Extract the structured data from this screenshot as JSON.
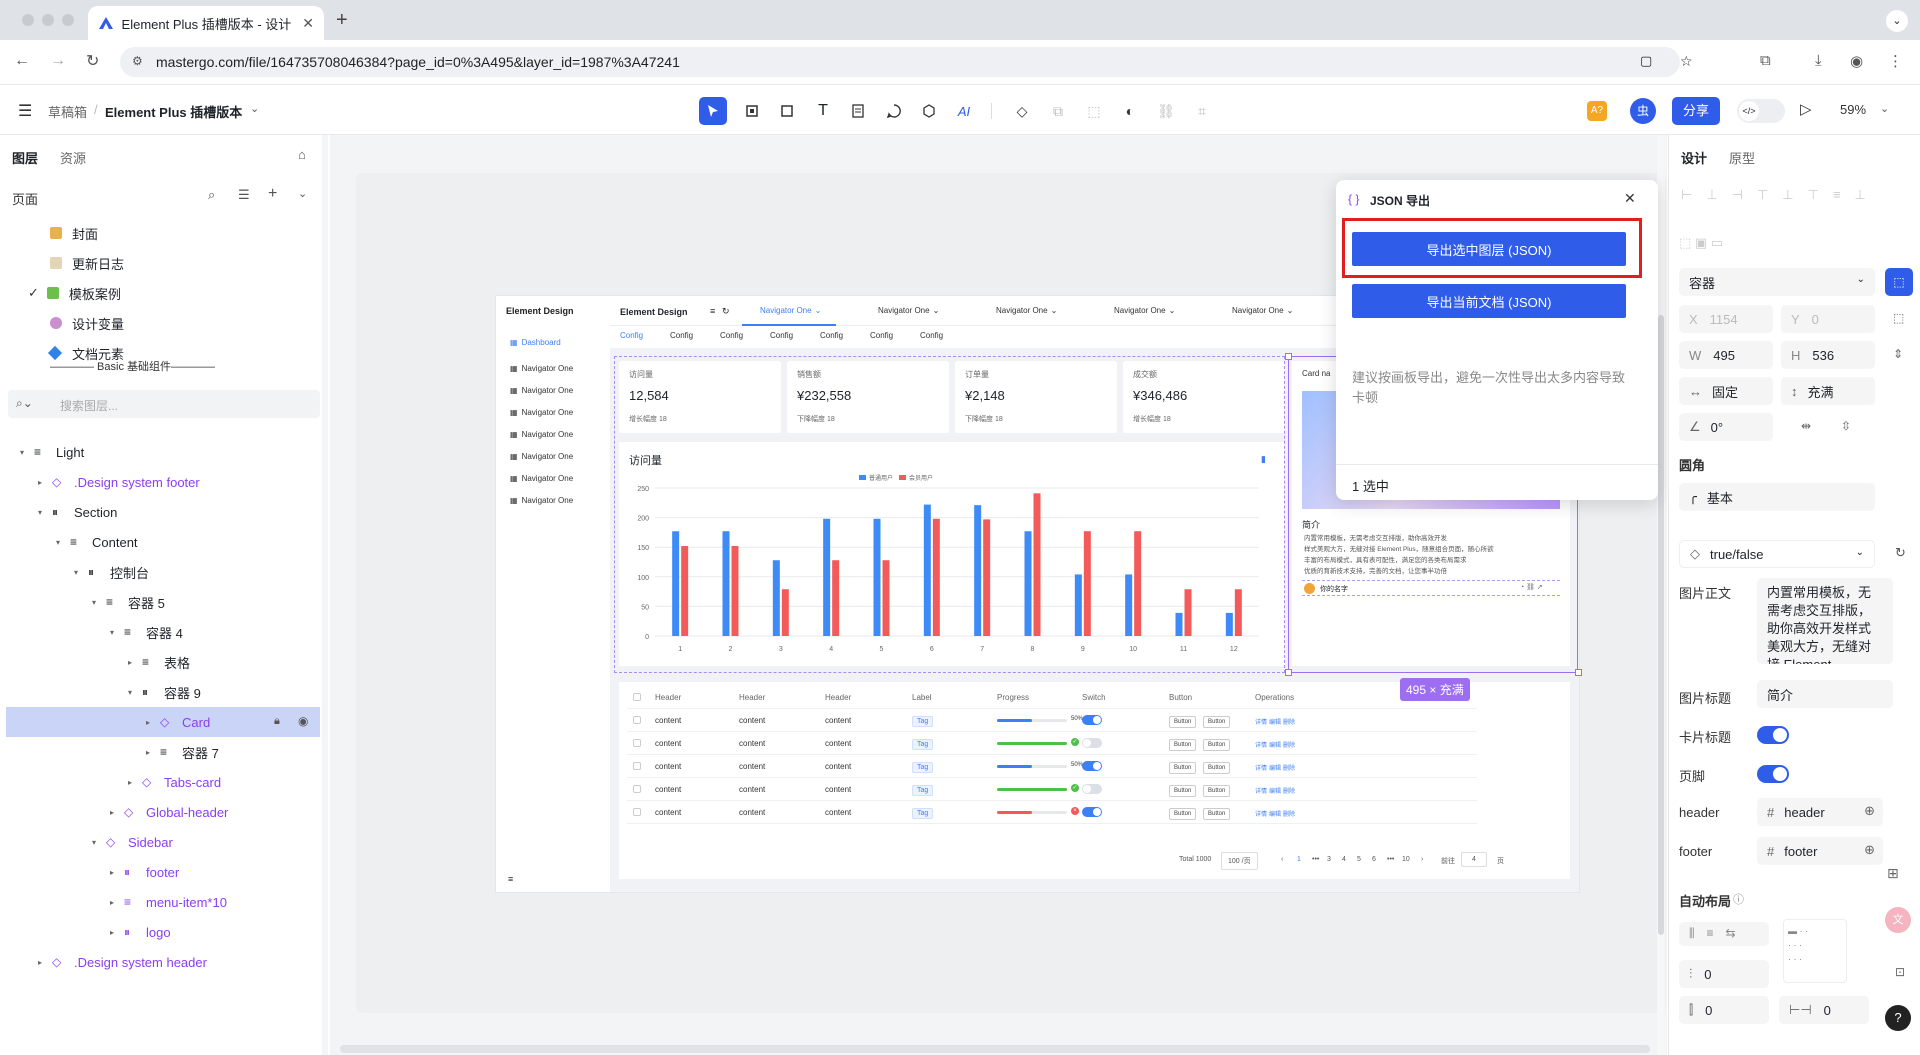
{
  "browser": {
    "tab_title": "Element Plus 插槽版本 - 设计",
    "url": "mastergo.com/file/164735708046384?page_id=0%3A495&layer_id=1987%3A47241"
  },
  "app": {
    "breadcrumb_root": "草稿箱",
    "file_name": "Element Plus 插槽版本",
    "share_label": "分享",
    "avatar_label": "虫",
    "warn_badge": "A?",
    "zoom": "59%"
  },
  "left": {
    "tabs": [
      "图层",
      "资源"
    ],
    "pages_label": "页面",
    "pages": [
      "封面",
      "更新日志",
      "模板案例",
      "设计变量",
      "文档元素",
      "———— Basic 基础组件————"
    ],
    "search_placeholder": "搜索图层...",
    "layers": [
      {
        "name": "Light"
      },
      {
        "name": ".Design system footer"
      },
      {
        "name": "Section"
      },
      {
        "name": "Content"
      },
      {
        "name": "控制台"
      },
      {
        "name": "容器 5"
      },
      {
        "name": "容器 4"
      },
      {
        "name": "表格"
      },
      {
        "name": "容器 9"
      },
      {
        "name": "Card"
      },
      {
        "name": "容器 7"
      },
      {
        "name": "Tabs-card"
      },
      {
        "name": "Global-header"
      },
      {
        "name": "Sidebar"
      },
      {
        "name": "footer"
      },
      {
        "name": "menu-item*10"
      },
      {
        "name": "logo"
      },
      {
        "name": ".Design system header"
      }
    ]
  },
  "right": {
    "tabs": [
      "设计",
      "原型"
    ],
    "container_select": "容器",
    "x": "1154",
    "y": "0",
    "w": "495",
    "h": "536",
    "x_label": "X",
    "y_label": "Y",
    "w_label": "W",
    "h_label": "H",
    "fixed": "固定",
    "fill": "充满",
    "rotation": "0°",
    "radius_label": "圆角",
    "radius_value": "基本",
    "variant_select": "true/false",
    "image_text_label": "图片正文",
    "image_text_value": "内置常用模板，无需考虑交互排版，助你高效开发样式美观大方，无缝对接 Element",
    "image_title_label": "图片标题",
    "image_title_value": "简介",
    "card_title_label": "卡片标题",
    "footer_toggle_label": "页脚",
    "header_label": "header",
    "header_value": "header",
    "footer_label": "footer",
    "footer_value": "footer",
    "autolayout_label": "自动布局",
    "pad1": "0",
    "pad2": "0",
    "pad3": "0"
  },
  "json_panel": {
    "title": "JSON 导出",
    "export_selected": "导出选中图层 (JSON)",
    "export_doc": "导出当前文档 (JSON)",
    "hint": "建议按画板导出，避免一次性导出太多内容导致卡顿",
    "selected_count": "1 选中"
  },
  "size_badge": "495 × 充满",
  "dashboard": {
    "logo": "Element Design",
    "sidebar_logo": "Element Design",
    "sidebar_active": "Dashboard",
    "sidebar_items": [
      "Navigator One",
      "Navigator One",
      "Navigator One",
      "Navigator One",
      "Navigator One",
      "Navigator One",
      "Navigator One"
    ],
    "top_nav": [
      "Navigator One",
      "Navigator One",
      "Navigator One",
      "Navigator One",
      "Navigator One"
    ],
    "sub_tabs": [
      "Config",
      "Config",
      "Config",
      "Config",
      "Config",
      "Config",
      "Config"
    ],
    "stats": [
      {
        "label": "访问量",
        "value": "12,584",
        "foot": "增长幅度 18"
      },
      {
        "label": "销售额",
        "value": "¥232,558",
        "foot": "下降幅度 18"
      },
      {
        "label": "订单量",
        "value": "¥2,148",
        "foot": "下降幅度 18"
      },
      {
        "label": "成交额",
        "value": "¥346,486",
        "foot": "增长幅度 18"
      }
    ],
    "card_header": "Card na",
    "card_title": "简介",
    "card_bullets": [
      "内置常用模板，无需考虑交互排版，助你高效开发",
      "样式美观大方，无缝对接 Element Plus，随意组合页面，随心所欲",
      "丰富的布局模式，具有表可配性，满足您的各类布局需求",
      "优质的育新技术支持，完善的文档，让您事半功倍"
    ],
    "card_user": "你的名字",
    "table": {
      "headers": [
        "Header",
        "Header",
        "Header",
        "Label",
        "Progress",
        "Switch",
        "Button",
        "Operations"
      ],
      "rows": [
        {
          "c1": "content",
          "c2": "content",
          "c3": "content",
          "tag": "Tag",
          "pct": "50%",
          "progress": 0.5,
          "on": true
        },
        {
          "c1": "content",
          "c2": "content",
          "c3": "content",
          "tag": "Tag",
          "pct": "",
          "progress": 1.0,
          "on": false
        },
        {
          "c1": "content",
          "c2": "content",
          "c3": "content",
          "tag": "Tag",
          "pct": "50%",
          "progress": 0.5,
          "on": true
        },
        {
          "c1": "content",
          "c2": "content",
          "c3": "content",
          "tag": "Tag",
          "pct": "",
          "progress": 1.0,
          "on": false
        },
        {
          "c1": "content",
          "c2": "content",
          "c3": "content",
          "tag": "Tag",
          "pct": "",
          "progress": 0.5,
          "on": true
        }
      ],
      "btn": "Button",
      "ops": [
        "详情",
        "编辑",
        "删除"
      ]
    },
    "pagination": {
      "total": "Total 1000",
      "per": "100 /页",
      "pages": [
        "1",
        "•••",
        "3",
        "4",
        "5",
        "6",
        "•••",
        "10"
      ],
      "goto": "前往",
      "goto_val": "4",
      "page_suffix": "页"
    }
  },
  "chart_data": {
    "type": "bar",
    "title": "访问量",
    "categories": [
      "1",
      "2",
      "3",
      "4",
      "5",
      "6",
      "7",
      "8",
      "9",
      "10",
      "11",
      "12"
    ],
    "series": [
      {
        "name": "普通用户",
        "color": "#3e8bf7",
        "values": [
          177,
          177,
          128,
          198,
          198,
          222,
          221,
          177,
          104,
          104,
          39,
          39
        ]
      },
      {
        "name": "会员用户",
        "color": "#f35b5b",
        "values": [
          152,
          152,
          79,
          128,
          128,
          198,
          197,
          241,
          177,
          177,
          79,
          79
        ]
      }
    ],
    "ylim": [
      0,
      250
    ],
    "yticks": [
      0,
      50,
      100,
      150,
      200,
      250
    ]
  }
}
